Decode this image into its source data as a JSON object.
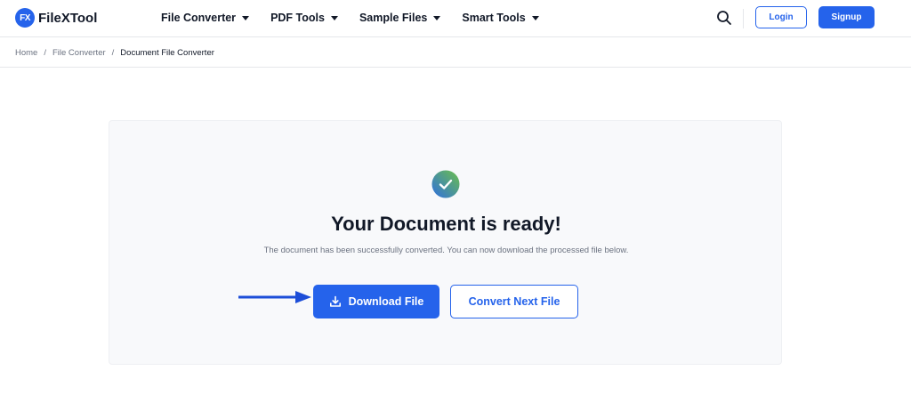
{
  "header": {
    "logo_badge": "FX",
    "logo_text": "FileXTool",
    "nav": [
      {
        "label": "File Converter"
      },
      {
        "label": "PDF Tools"
      },
      {
        "label": "Sample Files"
      },
      {
        "label": "Smart Tools"
      }
    ],
    "search_icon": "search-icon",
    "login_label": "Login",
    "signup_label": "Signup"
  },
  "breadcrumb": {
    "items": [
      "Home",
      "File Converter"
    ],
    "current": "Document File Converter",
    "separator": "/"
  },
  "result": {
    "status_icon": "check-circle-icon",
    "title": "Your Document is ready!",
    "description": "The document has been successfully converted. You can now download the processed file below.",
    "download_label": "Download File",
    "download_icon": "download-icon",
    "convert_next_label": "Convert Next File"
  },
  "annotation": {
    "arrow_icon": "arrow-right-icon"
  },
  "colors": {
    "accent": "#2563eb",
    "card_bg": "#f8f9fb",
    "check_gradient_start": "#2f6fe0",
    "check_gradient_end": "#6cc04a"
  }
}
